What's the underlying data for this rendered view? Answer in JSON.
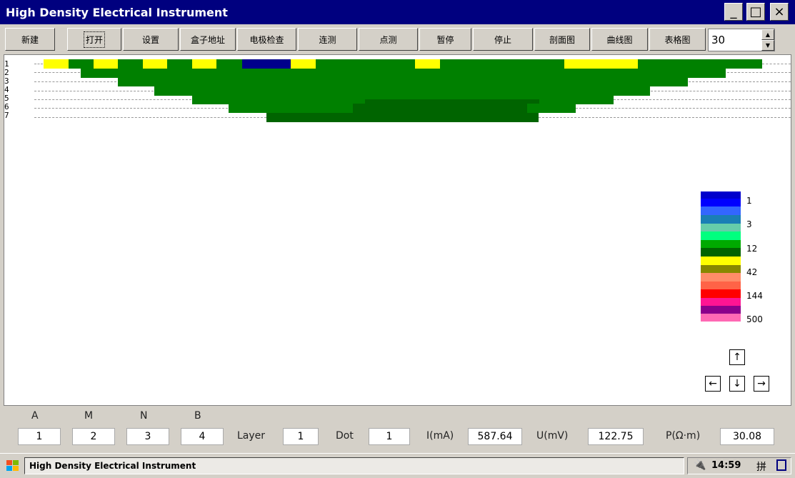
{
  "window": {
    "title": "High Density Electrical Instrument",
    "controls": {
      "minimize": "_",
      "maximize": "□",
      "close": "×"
    }
  },
  "toolbar": {
    "buttons": [
      "新建",
      "打开",
      "设置",
      "盒子地址",
      "电极检查",
      "连测",
      "点测",
      "暂停",
      "停止",
      "剖面图",
      "曲线图",
      "表格图"
    ],
    "spin_value": "30"
  },
  "canvas": {
    "row_labels": [
      "1",
      "2",
      "3",
      "4",
      "5",
      "6",
      "7"
    ],
    "colors": {
      "green": "#008000",
      "dark_green": "#006400",
      "yellow": "#ffff00",
      "navy": "#00008b"
    }
  },
  "legend": {
    "labels": [
      "1",
      "3",
      "12",
      "42",
      "144",
      "500"
    ],
    "colors": [
      "#0000cc",
      "#0000ff",
      "#3366ff",
      "#1a7fb5",
      "#66cdaa",
      "#00ff7f",
      "#00aa00",
      "#006400",
      "#ffff00",
      "#888800",
      "#ff8c69",
      "#ff6347",
      "#ff0000",
      "#ff1493",
      "#8b008b",
      "#ff69b4"
    ]
  },
  "nav": {
    "up": "↑",
    "left": "←",
    "down": "↓",
    "right": "→"
  },
  "bottom": {
    "A_label": "A",
    "A_value": "1",
    "M_label": "M",
    "M_value": "2",
    "N_label": "N",
    "N_value": "3",
    "B_label": "B",
    "B_value": "4",
    "layer_label": "Layer",
    "layer_value": "1",
    "dot_label": "Dot",
    "dot_value": "1",
    "i_label": "I(mA)",
    "i_value": "587.64",
    "u_label": "U(mV)",
    "u_value": "122.75",
    "p_label": "P(Ω·m)",
    "p_value": "30.08"
  },
  "taskbar": {
    "start_icon": "windows-flag",
    "task_label": "High Density Electrical Instrument",
    "time": "14:59",
    "ime": "拼"
  }
}
